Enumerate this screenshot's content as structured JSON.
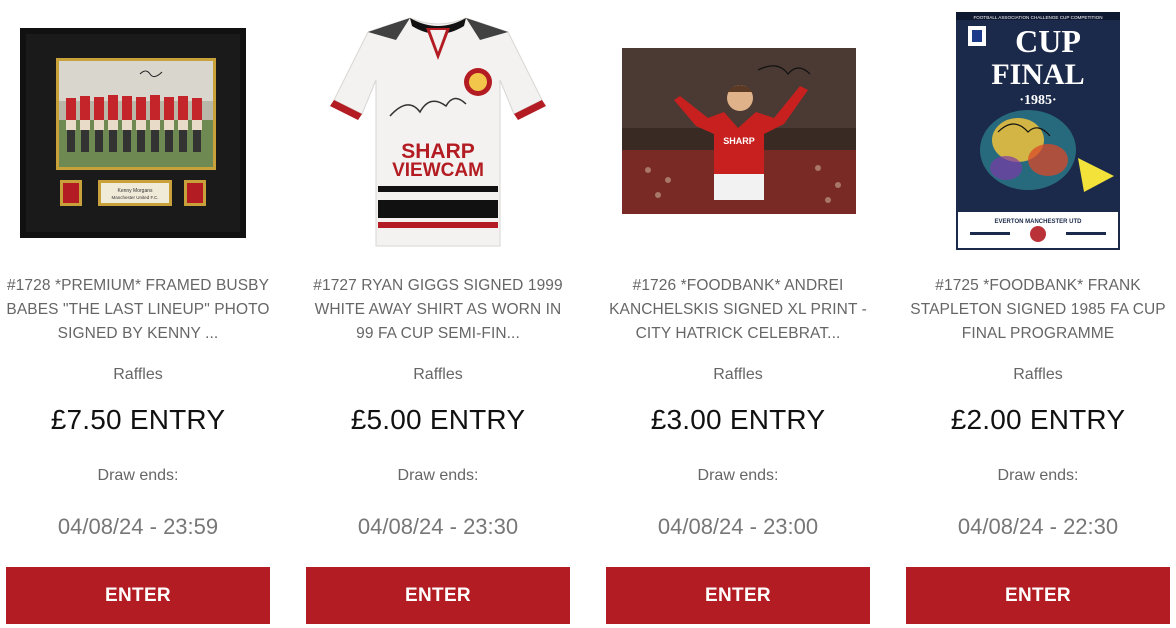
{
  "raffles": [
    {
      "title": "#1728 *PREMIUM* FRAMED BUSBY BABES \"THE LAST LINEUP\" PHOTO SIGNED BY KENNY ...",
      "category": "Raffles",
      "price": "£7.50 ENTRY",
      "draw_label": "Draw ends:",
      "draw_date": "04/08/24 - 23:59",
      "button_label": "ENTER",
      "image_caption": "Kenny Morgans\nManchester United F.C."
    },
    {
      "title": "#1727 RYAN GIGGS SIGNED 1999 WHITE AWAY SHIRT AS WORN IN 99 FA CUP SEMI-FIN...",
      "category": "Raffles",
      "price": "£5.00 ENTRY",
      "draw_label": "Draw ends:",
      "draw_date": "04/08/24 - 23:30",
      "button_label": "ENTER",
      "image_text": "SHARP VIEWCAM"
    },
    {
      "title": "#1726 *FOODBANK* ANDREI KANCHELSKIS SIGNED XL PRINT - CITY HATRICK CELEBRAT...",
      "category": "Raffles",
      "price": "£3.00 ENTRY",
      "draw_label": "Draw ends:",
      "draw_date": "04/08/24 - 23:00",
      "button_label": "ENTER",
      "image_text": "SHARP"
    },
    {
      "title": "#1725 *FOODBANK* FRANK STAPLETON SIGNED 1985 FA CUP FINAL PROGRAMME",
      "category": "Raffles",
      "price": "£2.00 ENTRY",
      "draw_label": "Draw ends:",
      "draw_date": "04/08/24 - 22:30",
      "button_label": "ENTER",
      "image_text": {
        "header": "FOOTBALL ASSOCIATION CHALLENGE CUP COMPETITION",
        "main": "CUP FINAL",
        "year": "·1985·",
        "teams": "EVERTON   MANCHESTER UTD"
      }
    }
  ],
  "colors": {
    "button_bg": "#b21c22",
    "button_text": "#ffffff",
    "title_text": "#666666",
    "price_text": "#111111"
  }
}
